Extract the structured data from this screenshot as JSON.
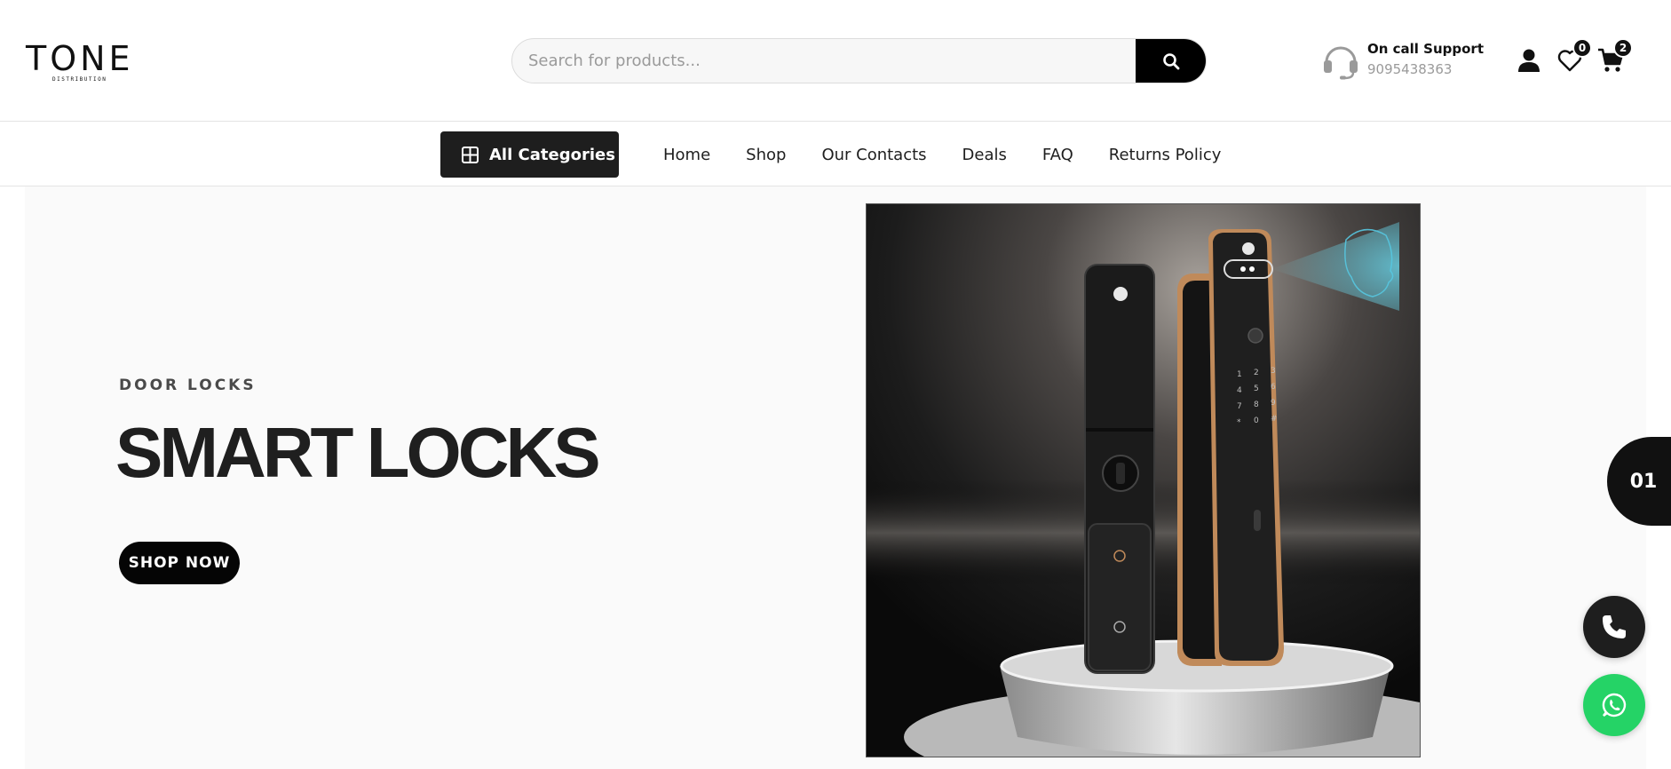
{
  "header": {
    "logo_text": "TONE",
    "logo_sub": "DISTRIBUTION",
    "search": {
      "placeholder": "Search for products..."
    },
    "support": {
      "title": "On call Support",
      "phone": "9095438363"
    },
    "wishlist_count": "0",
    "cart_count": "2"
  },
  "nav": {
    "all_categories": "All Categories",
    "links": [
      "Home",
      "Shop",
      "Our Contacts",
      "Deals",
      "FAQ",
      "Returns Policy"
    ]
  },
  "hero": {
    "eyebrow": "DOOR LOCKS",
    "headline": "SMART LOCKS",
    "cta": "SHOP NOW",
    "slide_number": "01"
  },
  "colors": {
    "primary": "#000000",
    "nav_button": "#1e1e1e",
    "whatsapp": "#25d366",
    "accent_bronze": "#c08a5a"
  }
}
